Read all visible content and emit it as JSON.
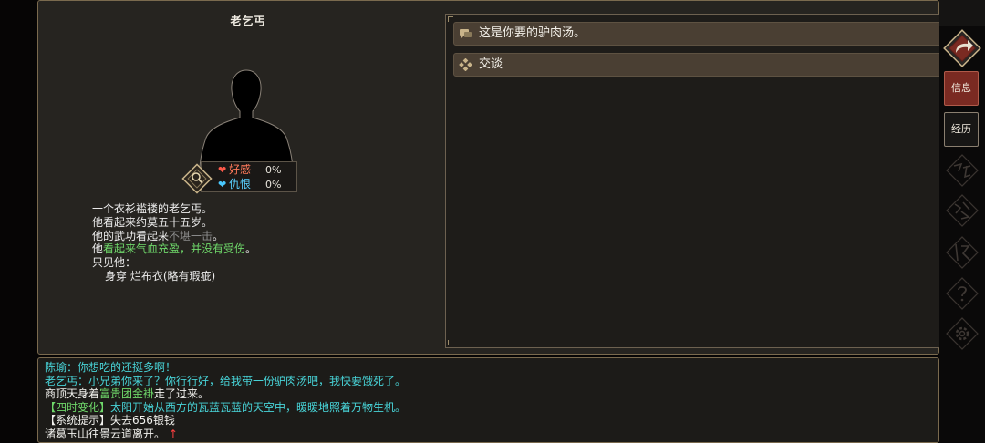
{
  "npc": {
    "name": "老乞丐",
    "favor_label": "好感",
    "favor_value": "0%",
    "hatred_label": "仇恨",
    "hatred_value": "0%",
    "description": {
      "line1": "一个衣衫褴褛的老乞丐。",
      "line2": "他看起来约莫五十五岁。",
      "line3_prefix": "他的武功看起来",
      "line3_grey": "不堪一击",
      "line3_suffix": "。",
      "line4_prefix": "他",
      "line4_green": "看起来气血充盈，并没有受伤",
      "line4_suffix": "。",
      "line5": "只见他：",
      "line6": "身穿 烂布衣(略有瑕疵)"
    }
  },
  "dialog": {
    "options": [
      {
        "label": "这是你要的驴肉汤。",
        "icon": "chat-bubble-icon"
      },
      {
        "label": "交谈",
        "icon": "diamond-dots-icon"
      }
    ]
  },
  "log": {
    "line1": "陈瑜：你想吃的还挺多啊！",
    "line2": "老乞丐：小兄弟你来了？你行行好，给我带一份驴肉汤吧，我快要饿死了。",
    "line3_a": "商顶天身着",
    "line3_b": "富贵团金褂",
    "line3_c": "走了过来。",
    "line4_a": "【四时变化】",
    "line4_b": "太阳开始从西方的瓦蓝瓦蓝的天空中，暖暖地照着万物生机。",
    "line5": "【系统提示】失去656银钱",
    "line6": "诸葛玉山往景云道离开。",
    "line6_arrow": "↑"
  },
  "sidebar": {
    "tab_info": "信息",
    "tab_history": "经历"
  },
  "colors": {
    "accent_red": "#7a2a22",
    "cyan_text": "#48d4d8",
    "green_text": "#6fd86a",
    "heart_red": "#ff5a4a",
    "heart_blue": "#4ac8ff"
  }
}
